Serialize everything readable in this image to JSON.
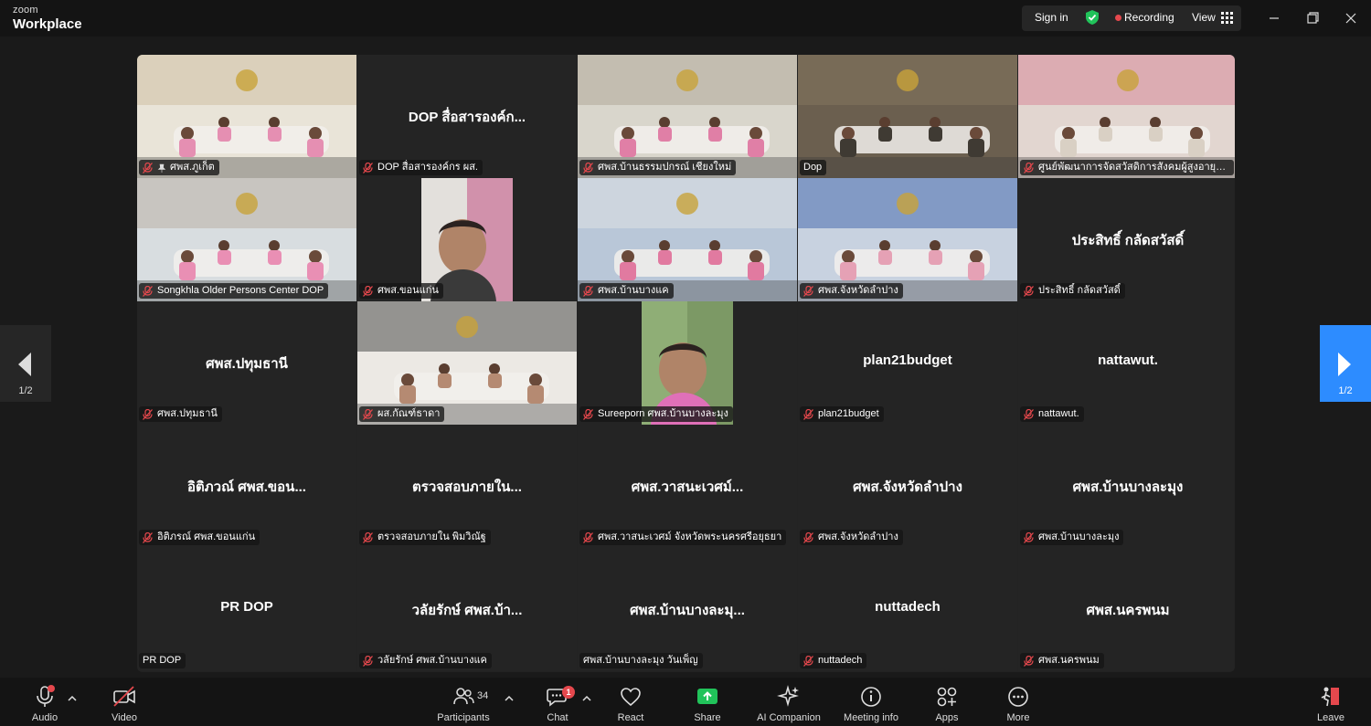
{
  "app": {
    "brand_top": "zoom",
    "brand_bottom": "Workplace"
  },
  "titlebar": {
    "sign_in": "Sign in",
    "recording": "Recording",
    "view": "View"
  },
  "pagination": {
    "current": "1/2"
  },
  "tiles": [
    {
      "label": "ศพส.ภูเก็ต",
      "display_name": "",
      "video": true,
      "pinned": true
    },
    {
      "label": "DOP สื่อสารองค์กร ผส.",
      "display_name": "DOP สื่อสารองค์ก...",
      "video": false
    },
    {
      "label": "ศพส.บ้านธรรมปกรณ์ เชียงใหม่",
      "display_name": "",
      "video": true
    },
    {
      "label": "Dop",
      "display_name": "",
      "video": true,
      "active": true,
      "muted": false
    },
    {
      "label": "ศูนย์พัฒนาการจัดสวัสดิการสังคมผู้สูงอายุบ้าน...",
      "display_name": "",
      "video": true
    },
    {
      "label": "Songkhla Older Persons Center DOP",
      "display_name": "",
      "video": true
    },
    {
      "label": "ศพส.ขอนแก่น",
      "display_name": "",
      "video": true,
      "portrait": true
    },
    {
      "label": "ศพส.บ้านบางแค",
      "display_name": "",
      "video": true
    },
    {
      "label": "ศพส.จังหวัดลำปาง",
      "display_name": "",
      "video": true
    },
    {
      "label": "ประสิทธิ์ กลัดสวัสดิ์",
      "display_name": "ประสิทธิ์ กลัดสวัสดิ์",
      "video": false
    },
    {
      "label": "ศพส.ปทุมธานี",
      "display_name": "ศพส.ปทุมธานี",
      "video": false
    },
    {
      "label": "ผส.กัณฑ์ธาดา",
      "display_name": "",
      "video": true
    },
    {
      "label": "Sureeporn ศพส.บ้านบางละมุง",
      "display_name": "",
      "video": true,
      "portrait": true
    },
    {
      "label": "plan21budget",
      "display_name": "plan21budget",
      "video": false
    },
    {
      "label": "nattawut.",
      "display_name": "nattawut.",
      "video": false
    },
    {
      "label": "อิติภรณ์ ศพส.ขอนแก่น",
      "display_name": "อิติภวณ์ ศพส.ขอน...",
      "video": false
    },
    {
      "label": "ตรวจสอบภายใน พิมวิณัฐ",
      "display_name": "ตรวจสอบภายใน...",
      "video": false
    },
    {
      "label": "ศพส.วาสนะเวศม์ จังหวัดพระนครศรีอยุธยา",
      "display_name": "ศพส.วาสนะเวศม์...",
      "video": false
    },
    {
      "label": "ศพส.จังหวัดลำปาง",
      "display_name": "ศพส.จังหวัดลำปาง",
      "video": false
    },
    {
      "label": "ศพส.บ้านบางละมุง",
      "display_name": "ศพส.บ้านบางละมุง",
      "video": false
    },
    {
      "label": "PR DOP",
      "display_name": "PR DOP",
      "video": false,
      "muted": false
    },
    {
      "label": "วลัยรักษ์  ศพส.บ้านบางแค",
      "display_name": "วลัยรักษ์  ศพส.บ้า...",
      "video": false
    },
    {
      "label": "ศพส.บ้านบางละมุง วันเพ็ญ",
      "display_name": "ศพส.บ้านบางละมุ...",
      "video": false,
      "muted": false
    },
    {
      "label": "nuttadech",
      "display_name": "nuttadech",
      "video": false
    },
    {
      "label": "ศพส.นครพนม",
      "display_name": "ศพส.นครพนม",
      "video": false
    }
  ],
  "toolbar": {
    "audio": "Audio",
    "video": "Video",
    "participants": "Participants",
    "participant_count": "34",
    "chat": "Chat",
    "chat_badge": "1",
    "react": "React",
    "share": "Share",
    "ai_companion": "AI Companion",
    "meeting_info": "Meeting info",
    "apps": "Apps",
    "more": "More",
    "leave": "Leave"
  },
  "colors": {
    "accent_blue": "#2d8cff",
    "active_speaker": "#20c46b",
    "muted_red": "#e5484d",
    "share_green": "#21c35a"
  }
}
